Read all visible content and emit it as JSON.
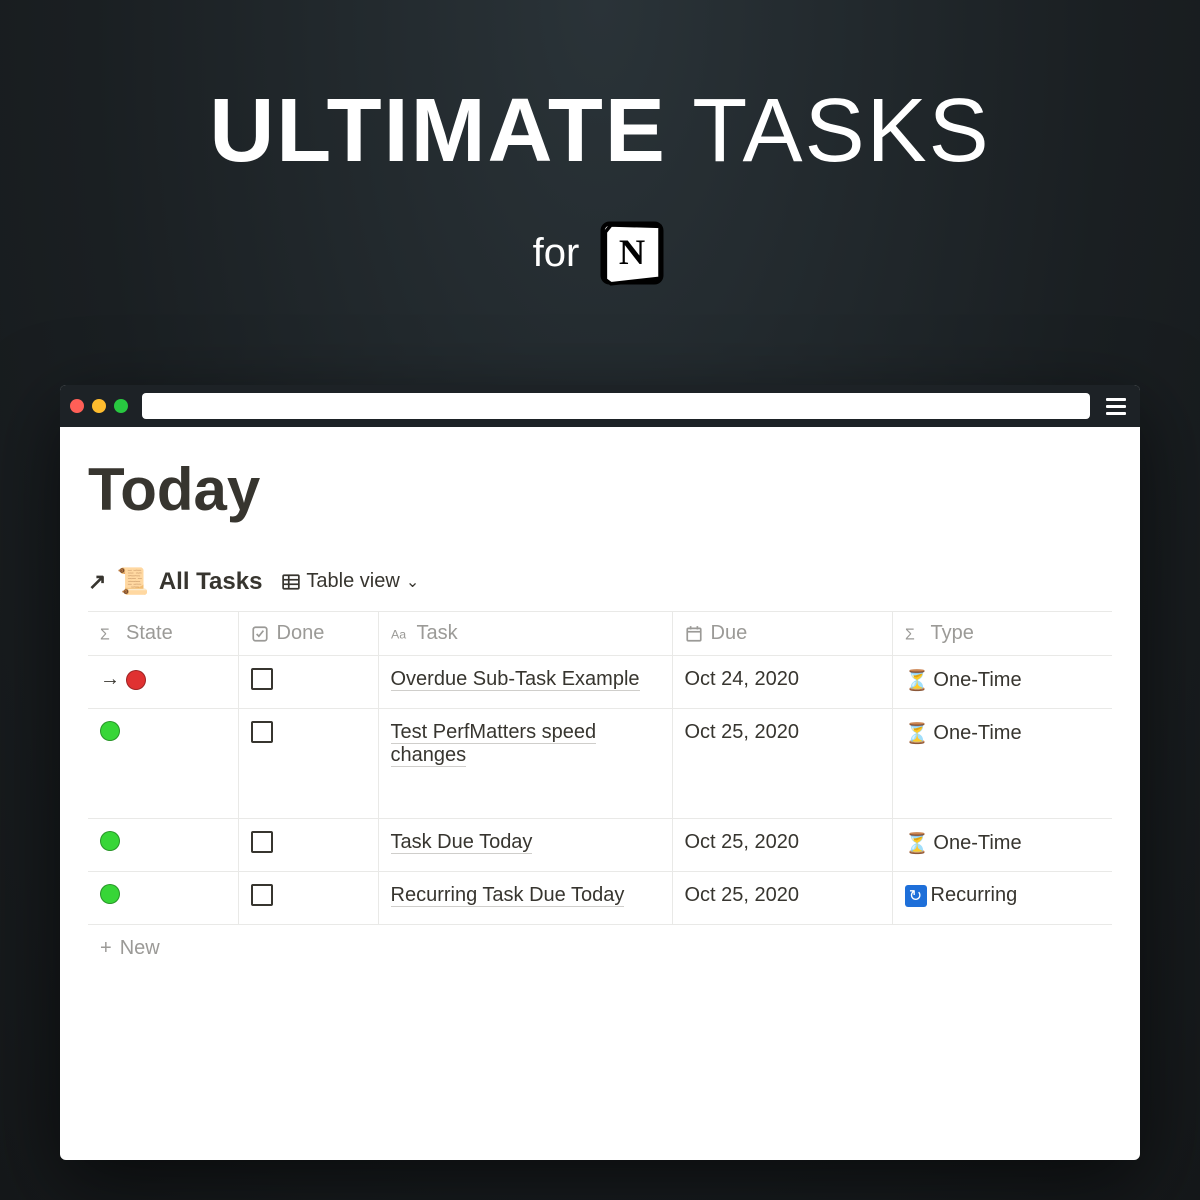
{
  "hero": {
    "title_bold": "ULTIMATE",
    "title_light": "TASKS",
    "subtitle": "for"
  },
  "page": {
    "title": "Today",
    "database_name": "All Tasks",
    "view_label": "Table view",
    "new_label": "New"
  },
  "columns": {
    "state": "State",
    "done": "Done",
    "task": "Task",
    "due": "Due",
    "type": "Type"
  },
  "rows": [
    {
      "state_color": "red",
      "state_has_arrow": true,
      "task": "Overdue Sub-Task Example",
      "due": "Oct 24, 2020",
      "type_icon": "hourglass",
      "type": "One-Time",
      "tall": false
    },
    {
      "state_color": "green",
      "state_has_arrow": false,
      "task": "Test PerfMatters speed changes",
      "due": "Oct 25, 2020",
      "type_icon": "hourglass",
      "type": "One-Time",
      "tall": true
    },
    {
      "state_color": "green",
      "state_has_arrow": false,
      "task": "Task Due Today",
      "due": "Oct 25, 2020",
      "type_icon": "hourglass",
      "type": "One-Time",
      "tall": false
    },
    {
      "state_color": "green",
      "state_has_arrow": false,
      "task": "Recurring Task Due Today",
      "due": "Oct 25, 2020",
      "type_icon": "recurring",
      "type": "Recurring",
      "tall": false
    }
  ]
}
